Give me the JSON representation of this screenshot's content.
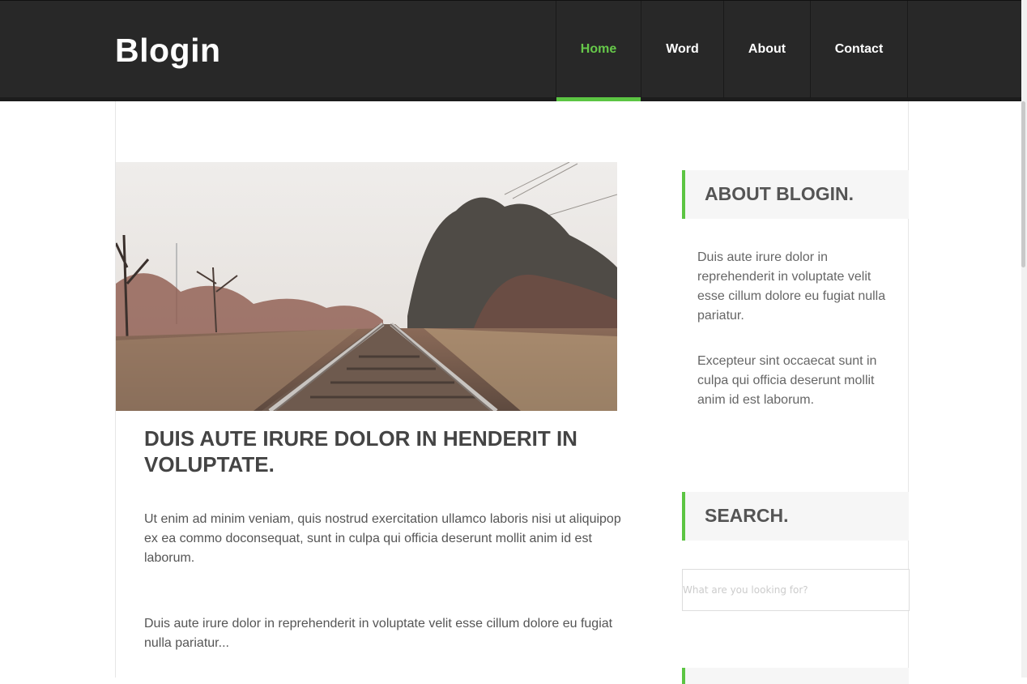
{
  "site": {
    "logo": "Blogin"
  },
  "nav": {
    "items": [
      {
        "label": "Home",
        "active": true
      },
      {
        "label": "Word",
        "active": false
      },
      {
        "label": "About",
        "active": false
      },
      {
        "label": "Contact",
        "active": false
      }
    ]
  },
  "post": {
    "image_alt": "railway-tracks-photo",
    "title": "DUIS AUTE IRURE DOLOR IN HENDERIT IN VOLUPTATE.",
    "paragraphs": [
      "Ut enim ad minim veniam, quis nostrud exercitation ullamco laboris nisi ut aliquipop ex ea commo doconsequat, sunt in culpa qui officia deserunt mollit anim id est laborum.",
      "Duis aute irure dolor in reprehenderit in voluptate velit esse cillum dolore eu fugiat nulla pariatur..."
    ]
  },
  "sidebar": {
    "about": {
      "title": "ABOUT BLOGIN.",
      "paragraphs": [
        "Duis aute irure dolor in reprehenderit in voluptate velit esse cillum dolore eu fugiat nulla pariatur.",
        "Excepteur sint occaecat sunt in culpa qui officia deserunt mollit anim id est laborum."
      ]
    },
    "search": {
      "title": "SEARCH.",
      "placeholder": "What are you looking for?",
      "value": ""
    }
  },
  "colors": {
    "header_bg": "#282828",
    "accent": "#5cc543",
    "heading_text": "#444444",
    "body_text": "#555555"
  }
}
